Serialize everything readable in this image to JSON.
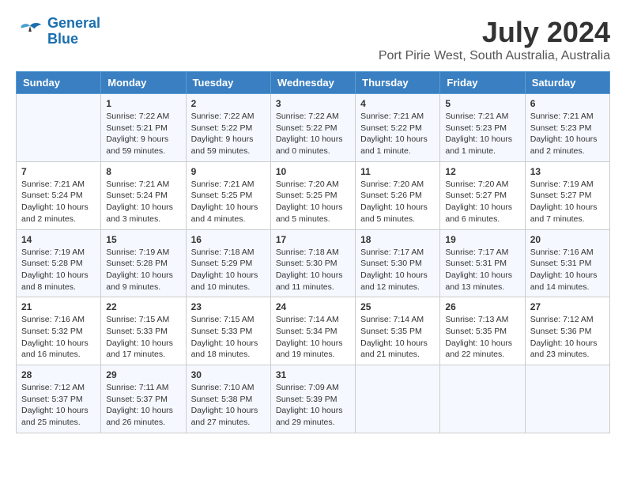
{
  "header": {
    "logo_line1": "General",
    "logo_line2": "Blue",
    "month": "July 2024",
    "location": "Port Pirie West, South Australia, Australia"
  },
  "columns": [
    "Sunday",
    "Monday",
    "Tuesday",
    "Wednesday",
    "Thursday",
    "Friday",
    "Saturday"
  ],
  "weeks": [
    [
      {
        "day": "",
        "info": ""
      },
      {
        "day": "1",
        "info": "Sunrise: 7:22 AM\nSunset: 5:21 PM\nDaylight: 9 hours\nand 59 minutes."
      },
      {
        "day": "2",
        "info": "Sunrise: 7:22 AM\nSunset: 5:22 PM\nDaylight: 9 hours\nand 59 minutes."
      },
      {
        "day": "3",
        "info": "Sunrise: 7:22 AM\nSunset: 5:22 PM\nDaylight: 10 hours\nand 0 minutes."
      },
      {
        "day": "4",
        "info": "Sunrise: 7:21 AM\nSunset: 5:22 PM\nDaylight: 10 hours\nand 1 minute."
      },
      {
        "day": "5",
        "info": "Sunrise: 7:21 AM\nSunset: 5:23 PM\nDaylight: 10 hours\nand 1 minute."
      },
      {
        "day": "6",
        "info": "Sunrise: 7:21 AM\nSunset: 5:23 PM\nDaylight: 10 hours\nand 2 minutes."
      }
    ],
    [
      {
        "day": "7",
        "info": "Sunrise: 7:21 AM\nSunset: 5:24 PM\nDaylight: 10 hours\nand 2 minutes."
      },
      {
        "day": "8",
        "info": "Sunrise: 7:21 AM\nSunset: 5:24 PM\nDaylight: 10 hours\nand 3 minutes."
      },
      {
        "day": "9",
        "info": "Sunrise: 7:21 AM\nSunset: 5:25 PM\nDaylight: 10 hours\nand 4 minutes."
      },
      {
        "day": "10",
        "info": "Sunrise: 7:20 AM\nSunset: 5:25 PM\nDaylight: 10 hours\nand 5 minutes."
      },
      {
        "day": "11",
        "info": "Sunrise: 7:20 AM\nSunset: 5:26 PM\nDaylight: 10 hours\nand 5 minutes."
      },
      {
        "day": "12",
        "info": "Sunrise: 7:20 AM\nSunset: 5:27 PM\nDaylight: 10 hours\nand 6 minutes."
      },
      {
        "day": "13",
        "info": "Sunrise: 7:19 AM\nSunset: 5:27 PM\nDaylight: 10 hours\nand 7 minutes."
      }
    ],
    [
      {
        "day": "14",
        "info": "Sunrise: 7:19 AM\nSunset: 5:28 PM\nDaylight: 10 hours\nand 8 minutes."
      },
      {
        "day": "15",
        "info": "Sunrise: 7:19 AM\nSunset: 5:28 PM\nDaylight: 10 hours\nand 9 minutes."
      },
      {
        "day": "16",
        "info": "Sunrise: 7:18 AM\nSunset: 5:29 PM\nDaylight: 10 hours\nand 10 minutes."
      },
      {
        "day": "17",
        "info": "Sunrise: 7:18 AM\nSunset: 5:30 PM\nDaylight: 10 hours\nand 11 minutes."
      },
      {
        "day": "18",
        "info": "Sunrise: 7:17 AM\nSunset: 5:30 PM\nDaylight: 10 hours\nand 12 minutes."
      },
      {
        "day": "19",
        "info": "Sunrise: 7:17 AM\nSunset: 5:31 PM\nDaylight: 10 hours\nand 13 minutes."
      },
      {
        "day": "20",
        "info": "Sunrise: 7:16 AM\nSunset: 5:31 PM\nDaylight: 10 hours\nand 14 minutes."
      }
    ],
    [
      {
        "day": "21",
        "info": "Sunrise: 7:16 AM\nSunset: 5:32 PM\nDaylight: 10 hours\nand 16 minutes."
      },
      {
        "day": "22",
        "info": "Sunrise: 7:15 AM\nSunset: 5:33 PM\nDaylight: 10 hours\nand 17 minutes."
      },
      {
        "day": "23",
        "info": "Sunrise: 7:15 AM\nSunset: 5:33 PM\nDaylight: 10 hours\nand 18 minutes."
      },
      {
        "day": "24",
        "info": "Sunrise: 7:14 AM\nSunset: 5:34 PM\nDaylight: 10 hours\nand 19 minutes."
      },
      {
        "day": "25",
        "info": "Sunrise: 7:14 AM\nSunset: 5:35 PM\nDaylight: 10 hours\nand 21 minutes."
      },
      {
        "day": "26",
        "info": "Sunrise: 7:13 AM\nSunset: 5:35 PM\nDaylight: 10 hours\nand 22 minutes."
      },
      {
        "day": "27",
        "info": "Sunrise: 7:12 AM\nSunset: 5:36 PM\nDaylight: 10 hours\nand 23 minutes."
      }
    ],
    [
      {
        "day": "28",
        "info": "Sunrise: 7:12 AM\nSunset: 5:37 PM\nDaylight: 10 hours\nand 25 minutes."
      },
      {
        "day": "29",
        "info": "Sunrise: 7:11 AM\nSunset: 5:37 PM\nDaylight: 10 hours\nand 26 minutes."
      },
      {
        "day": "30",
        "info": "Sunrise: 7:10 AM\nSunset: 5:38 PM\nDaylight: 10 hours\nand 27 minutes."
      },
      {
        "day": "31",
        "info": "Sunrise: 7:09 AM\nSunset: 5:39 PM\nDaylight: 10 hours\nand 29 minutes."
      },
      {
        "day": "",
        "info": ""
      },
      {
        "day": "",
        "info": ""
      },
      {
        "day": "",
        "info": ""
      }
    ]
  ]
}
